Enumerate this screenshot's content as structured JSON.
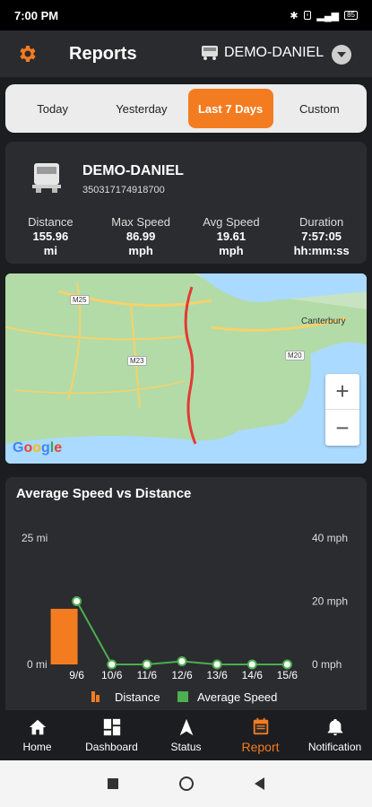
{
  "status_bar": {
    "time": "7:00 PM",
    "battery": "85"
  },
  "header": {
    "title": "Reports",
    "device": "DEMO-DANIEL"
  },
  "tabs": [
    {
      "label": "Today",
      "active": false
    },
    {
      "label": "Yesterday",
      "active": false
    },
    {
      "label": "Last 7 Days",
      "active": true
    },
    {
      "label": "Custom",
      "active": false
    }
  ],
  "summary": {
    "name": "DEMO-DANIEL",
    "imei": "350317174918700",
    "stats": [
      {
        "label": "Distance",
        "value": "155.96",
        "unit": "mi"
      },
      {
        "label": "Max Speed",
        "value": "86.99",
        "unit": "mph"
      },
      {
        "label": "Avg Speed",
        "value": "19.61",
        "unit": "mph"
      },
      {
        "label": "Duration",
        "value": "7:57:05",
        "unit": "hh:mm:ss"
      }
    ]
  },
  "map": {
    "labels": [
      "Canterbury"
    ],
    "roads": [
      "M25",
      "M23",
      "M20"
    ],
    "zoom_in": "+",
    "zoom_out": "−",
    "logo": "Google"
  },
  "chart_data": {
    "type": "bar+line",
    "title": "Average Speed vs Distance",
    "categories": [
      "9/6",
      "10/6",
      "11/6",
      "12/6",
      "13/6",
      "14/6",
      "15/6"
    ],
    "left_axis": {
      "ticks": [
        "25 mi",
        "0 mi"
      ],
      "range": [
        0,
        25
      ]
    },
    "right_axis": {
      "ticks": [
        "40 mph",
        "20 mph",
        "0 mph"
      ],
      "range": [
        0,
        40
      ]
    },
    "series": [
      {
        "name": "Distance",
        "type": "bar",
        "color": "#f47c20",
        "values": [
          11,
          0,
          0,
          0,
          0,
          0,
          0
        ]
      },
      {
        "name": "Average Speed",
        "type": "line",
        "color": "#4caf50",
        "values": [
          20,
          0,
          0,
          1,
          0,
          0,
          0
        ]
      }
    ],
    "legend_position": "bottom"
  },
  "bottom_nav": [
    {
      "label": "Home",
      "icon": "home-icon",
      "active": false
    },
    {
      "label": "Dashboard",
      "icon": "dashboard-icon",
      "active": false
    },
    {
      "label": "Status",
      "icon": "status-icon",
      "active": false
    },
    {
      "label": "Report",
      "icon": "report-icon",
      "active": true
    },
    {
      "label": "Notification",
      "icon": "bell-icon",
      "active": false
    }
  ],
  "colors": {
    "accent": "#f47c20",
    "line": "#4caf50",
    "card": "#2b2c2f",
    "bg": "#1c1d20"
  }
}
